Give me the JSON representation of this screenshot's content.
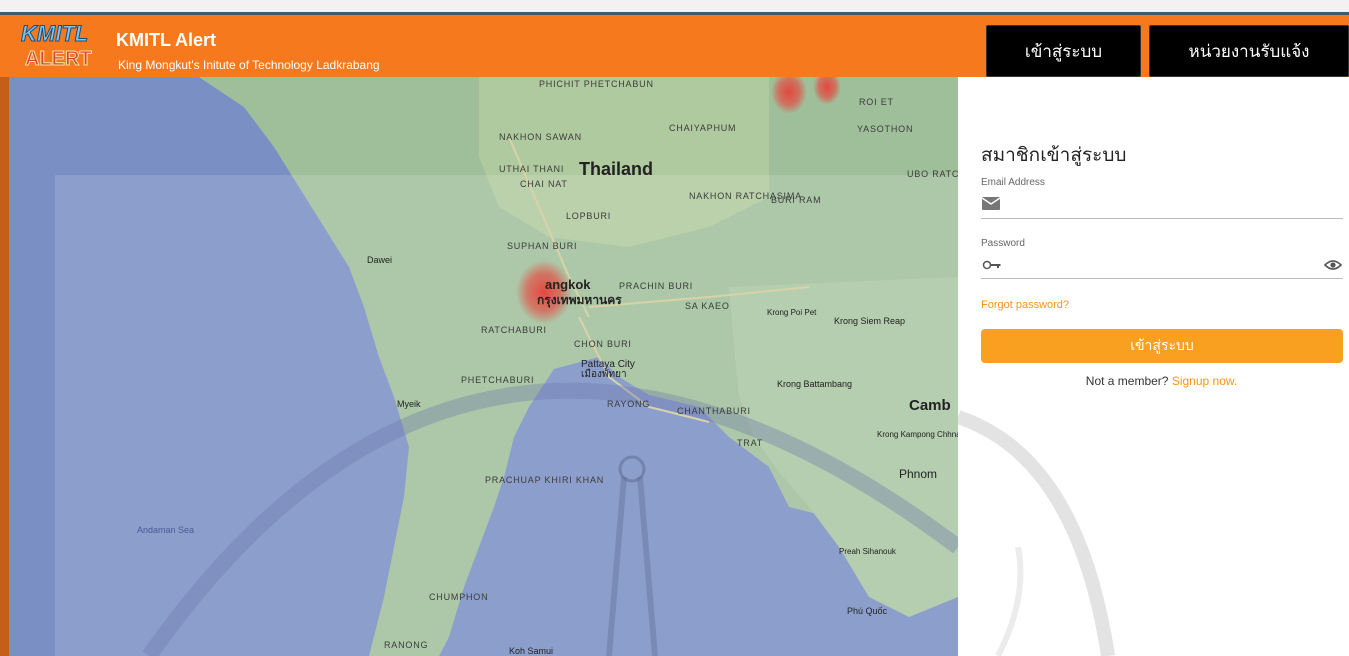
{
  "header": {
    "logo_top": "KMITL",
    "logo_bottom": "ALERT",
    "title": "KMITL Alert",
    "subtitle": "King Mongkut's Initute of Technology Ladkrabang",
    "nav_login": "เข้าสู่ระบบ",
    "nav_register": "หน่วยงานรับแจ้ง"
  },
  "map": {
    "labels": {
      "phichit": "PHICHIT PHETCHABUN",
      "nakhon_sawan": "NAKHON SAWAN",
      "chaiyaphum": "CHAIYAPHUM",
      "roi_et": "ROI ET",
      "yasothon": "YASOTHON",
      "uthai_thani": "UTHAI THANI",
      "thailand": "Thailand",
      "chai_nat": "CHAI NAT",
      "nakhon_ratchasima": "NAKHON RATCHASIMA",
      "buri_ram": "BURI RAM",
      "ubon": "UBO RATCHA",
      "lopburi": "LOPBURI",
      "suphan_buri": "SUPHAN BURI",
      "dawei": "Dawei",
      "bangkok": "angkok",
      "bangkok_th": "กรุงเทพมหานคร",
      "prachin_buri": "PRACHIN BURI",
      "sa_kaeo": "SA KAEO",
      "krong_poi_pet": "Krong Poi Pet",
      "krong_siem_reap": "Krong Siem Reap",
      "ratchaburi": "RATCHABURI",
      "chon_buri": "CHON BURI",
      "pattaya": "Pattaya City",
      "pattaya_th": "เมืองพัทยา",
      "phetchaburi": "PHETCHABURI",
      "krong_battambang": "Krong Battambang",
      "cambodia": "Camb",
      "myeik": "Myeik",
      "rayong": "RAYONG",
      "chanthaburi": "CHANTHABURI",
      "trat": "TRAT",
      "krong_kampong": "Krong Kampong Chhnang",
      "phnom_penh": "Phnom",
      "prachuap": "PRACHUAP KHIRI KHAN",
      "andaman": "Andaman Sea",
      "preah": "Preah Sihanouk",
      "chumphon": "CHUMPHON",
      "phu_quoc": "Phú Quốc",
      "ranong": "RANONG",
      "koh_samui": "Koh Samui"
    }
  },
  "login": {
    "title": "สมาชิกเข้าสู่ระบบ",
    "email_label": "Email Address",
    "email_value": "",
    "password_label": "Password",
    "password_value": "",
    "forgot": "Forgot password?",
    "submit": "เข้าสู่ระบบ",
    "not_member": "Not a member?",
    "signup": "Signup now."
  },
  "colors": {
    "brand_orange": "#f7791d",
    "button_orange": "#f9a020",
    "link_orange": "#f7941d",
    "map_water": "#7a90c4",
    "map_land": "#9fbf9a"
  }
}
